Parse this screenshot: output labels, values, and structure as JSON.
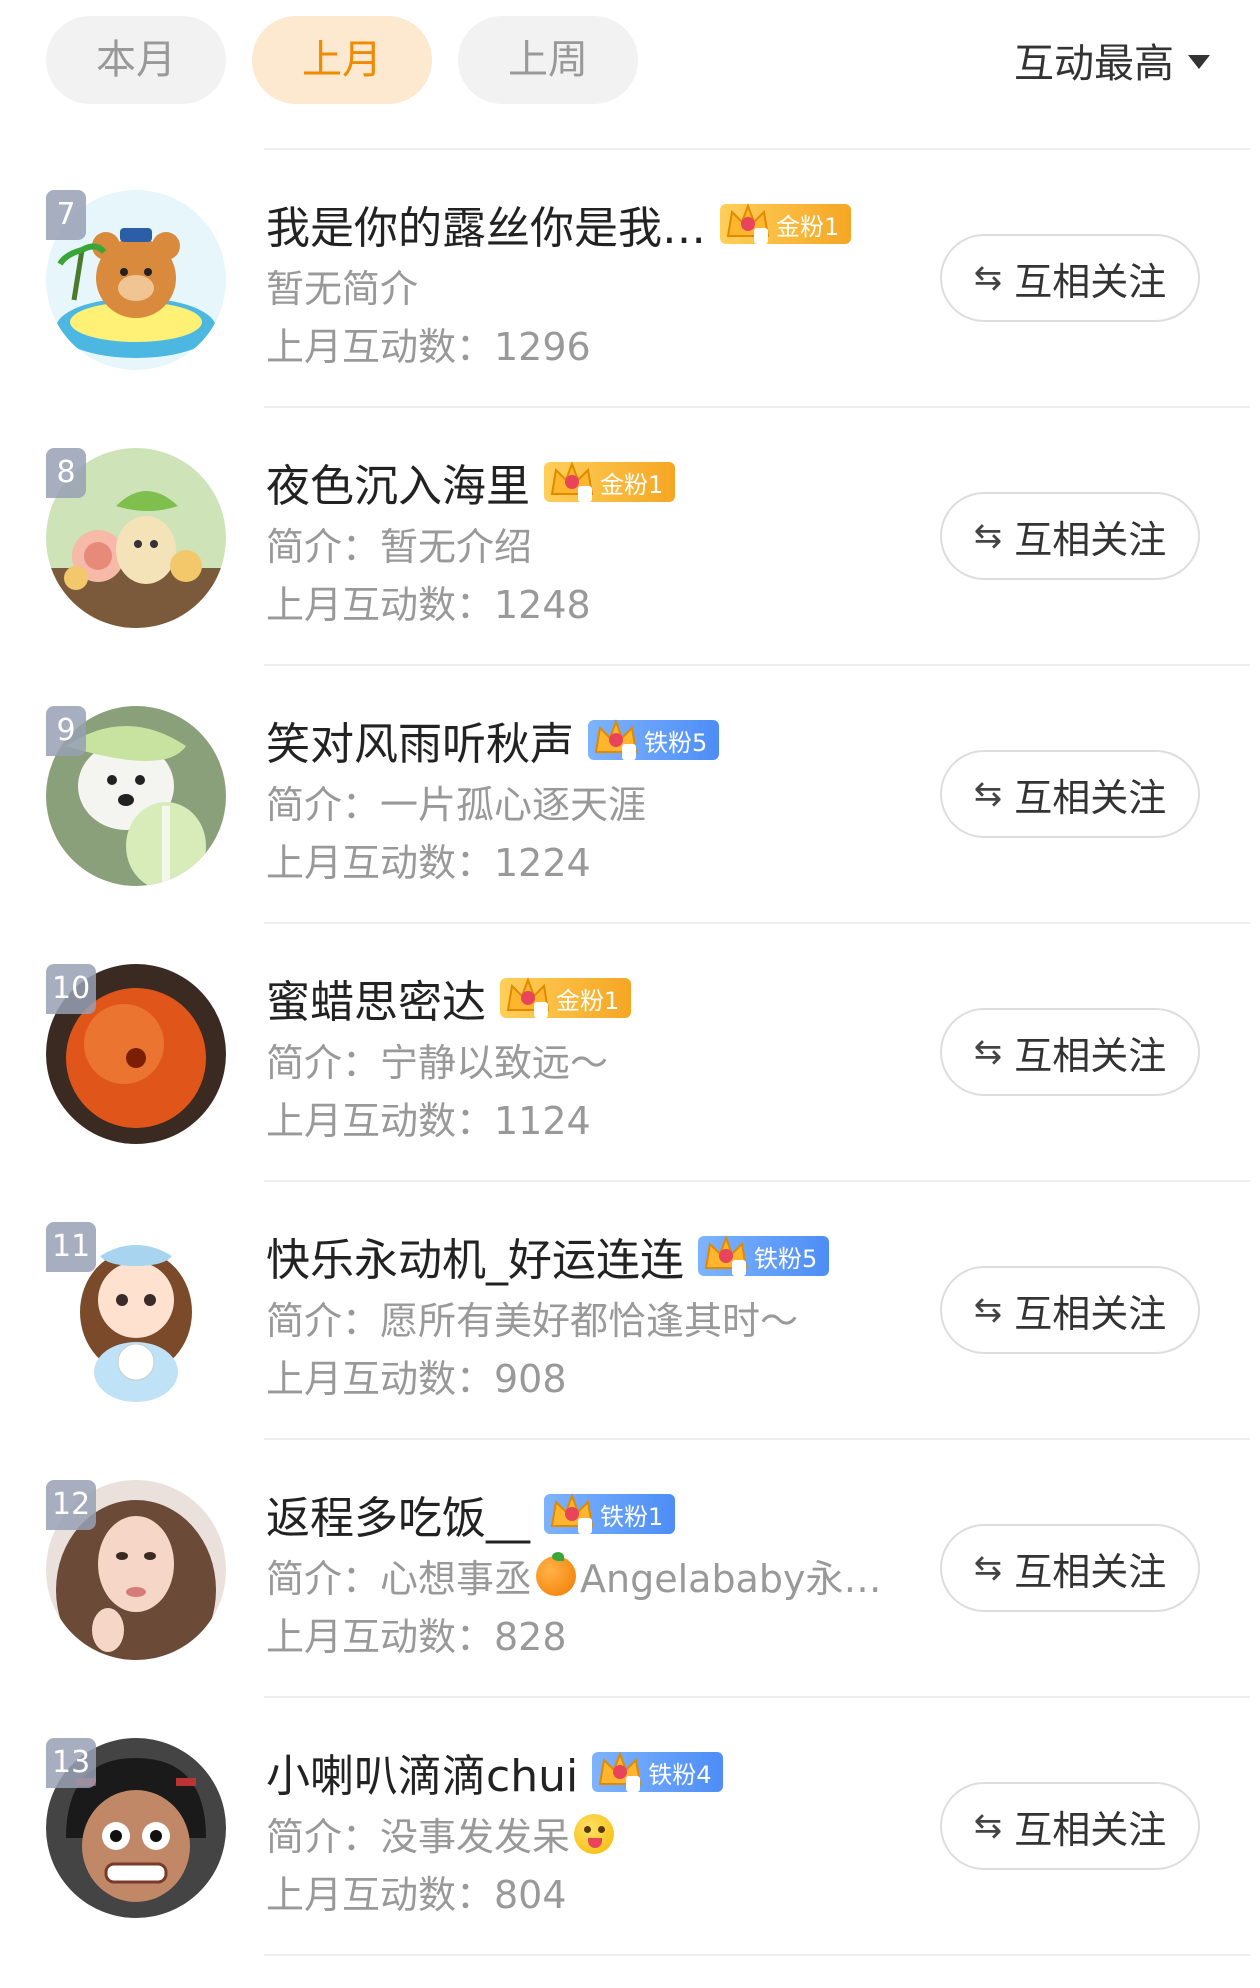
{
  "tabs": [
    {
      "label": "本月",
      "active": false
    },
    {
      "label": "上月",
      "active": true
    },
    {
      "label": "上周",
      "active": false
    }
  ],
  "sort": {
    "label": "互动最高"
  },
  "colors": {
    "accent": "#f08a00",
    "accent_bg": "#fde8d0",
    "gold_badge": "#f5a623",
    "iron_badge": "#4d8df5"
  },
  "follow_icon": "⇆",
  "follow_label": "互相关注",
  "users": [
    {
      "rank": "7",
      "name": "我是你的露丝你是我…",
      "badge": {
        "type": "gold",
        "label": "金粉1"
      },
      "bio": "暂无简介",
      "bio_emoji": "",
      "bio_suffix": "",
      "stat": "上月互动数：1296",
      "avatar": "bear-float"
    },
    {
      "rank": "8",
      "name": "夜色沉入海里",
      "badge": {
        "type": "gold",
        "label": "金粉1"
      },
      "bio": "简介：暂无介绍",
      "bio_emoji": "",
      "bio_suffix": "",
      "stat": "上月互动数：1248",
      "avatar": "snails"
    },
    {
      "rank": "9",
      "name": "笑对风雨听秋声",
      "badge": {
        "type": "iron",
        "label": "铁粉5"
      },
      "bio": "简介：一片孤心逐天涯",
      "bio_emoji": "",
      "bio_suffix": "",
      "stat": "上月互动数：1224",
      "avatar": "dog-cabbage"
    },
    {
      "rank": "10",
      "name": "蜜蜡思密达",
      "badge": {
        "type": "gold",
        "label": "金粉1"
      },
      "bio": "简介：宁静以致远～",
      "bio_emoji": "",
      "bio_suffix": "",
      "stat": "上月互动数：1124",
      "avatar": "amber-bead"
    },
    {
      "rank": "11",
      "name": "快乐永动机_好运连连",
      "badge": {
        "type": "iron",
        "label": "铁粉5"
      },
      "bio": "简介：愿所有美好都恰逢其时～",
      "bio_emoji": "",
      "bio_suffix": "",
      "stat": "上月互动数：908",
      "avatar": "cartoon-girl"
    },
    {
      "rank": "12",
      "name": "返程多吃饭__",
      "badge": {
        "type": "iron",
        "label": "铁粉1"
      },
      "bio": "简介：心想事丞",
      "bio_emoji": "orange",
      "bio_suffix": " Angelababy永…",
      "stat": "上月互动数：828",
      "avatar": "portrait"
    },
    {
      "rank": "13",
      "name": "小喇叭滴滴chui",
      "badge": {
        "type": "iron",
        "label": "铁粉4"
      },
      "bio": "简介：没事发发呆",
      "bio_emoji": "face",
      "bio_suffix": "",
      "stat": "上月互动数：804",
      "avatar": "cartoon-face"
    }
  ]
}
